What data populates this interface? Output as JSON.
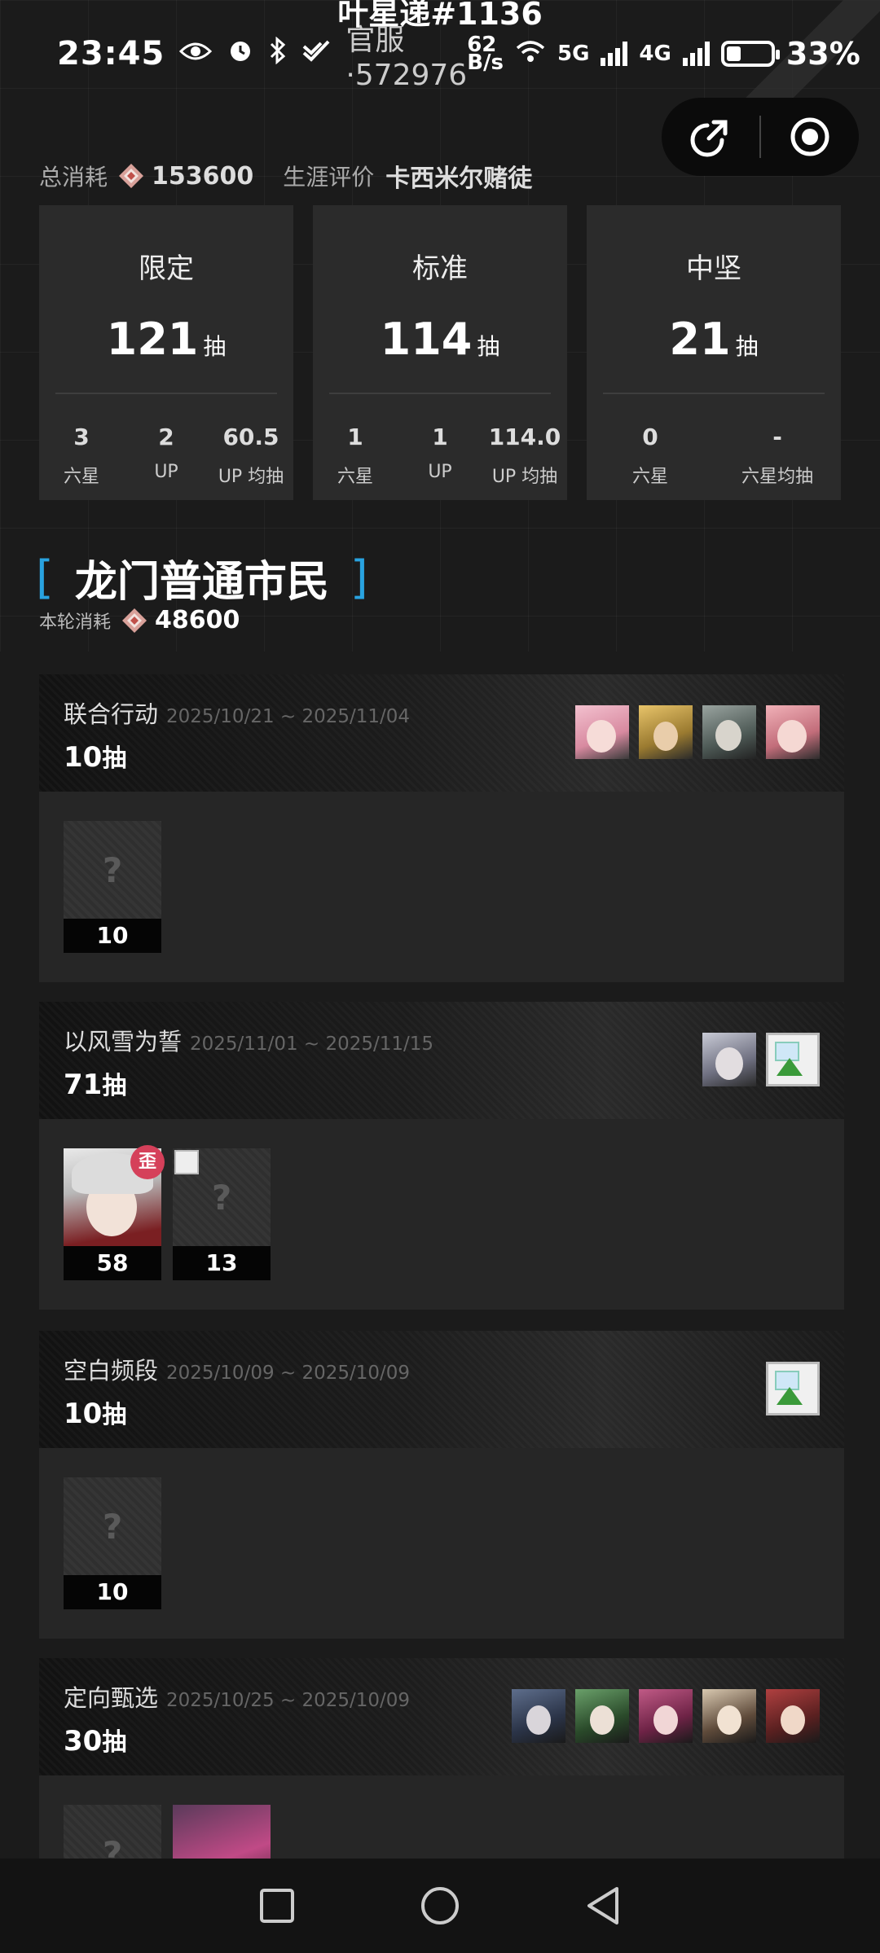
{
  "page_title": "叶星递#1136",
  "status": {
    "time": "23:45",
    "server": "官服·572976",
    "speed_top": "62",
    "speed_bottom": "B/s",
    "net1": "5G",
    "net2": "4G",
    "battery": "33%",
    "battery_level": 0.33
  },
  "summary": {
    "total_label": "总消耗",
    "total_value": "153600",
    "career_label": "生涯评价",
    "career_value": "卡西米尔赌徒"
  },
  "stats": [
    {
      "category": "限定",
      "count": "121",
      "unit": "抽",
      "cells": [
        {
          "num": "3",
          "label": "六星"
        },
        {
          "num": "2",
          "label": "UP"
        },
        {
          "num": "60.5",
          "label": "UP 均抽"
        }
      ]
    },
    {
      "category": "标准",
      "count": "114",
      "unit": "抽",
      "cells": [
        {
          "num": "1",
          "label": "六星"
        },
        {
          "num": "1",
          "label": "UP"
        },
        {
          "num": "114.0",
          "label": "UP 均抽"
        }
      ]
    },
    {
      "category": "中坚",
      "count": "21",
      "unit": "抽",
      "cells": [
        {
          "num": "0",
          "label": "六星"
        },
        {
          "num": "-",
          "label": "六星均抽"
        }
      ]
    }
  ],
  "section": {
    "title": "龙门普通市民",
    "round_cost_label": "本轮消耗",
    "round_cost_value": "48600"
  },
  "banners": [
    {
      "name": "联合行动",
      "date": "2025/10/21 ~ 2025/11/04",
      "pulls": "10",
      "pulls_unit": "抽",
      "results": [
        {
          "count": "10",
          "unknown": "?"
        }
      ]
    },
    {
      "name": "以风雪为誓",
      "date": "2025/11/01 ~ 2025/11/15",
      "pulls": "71",
      "pulls_unit": "抽",
      "results": [
        {
          "count": "58",
          "badge": "歪"
        },
        {
          "count": "13",
          "unknown": "?"
        }
      ]
    },
    {
      "name": "空白频段",
      "date": "2025/10/09 ~ 2025/10/09",
      "pulls": "10",
      "pulls_unit": "抽",
      "results": [
        {
          "count": "10",
          "unknown": "?"
        }
      ]
    },
    {
      "name": "定向甄选",
      "date": "2025/10/25 ~ 2025/10/09",
      "pulls": "30",
      "pulls_unit": "抽",
      "results": [
        {
          "unknown": "?"
        }
      ]
    }
  ],
  "colors": {
    "accent": "#29a3e0",
    "badge": "#d5405a",
    "background": "#1b1b1b",
    "card": "#2b2b2b"
  }
}
